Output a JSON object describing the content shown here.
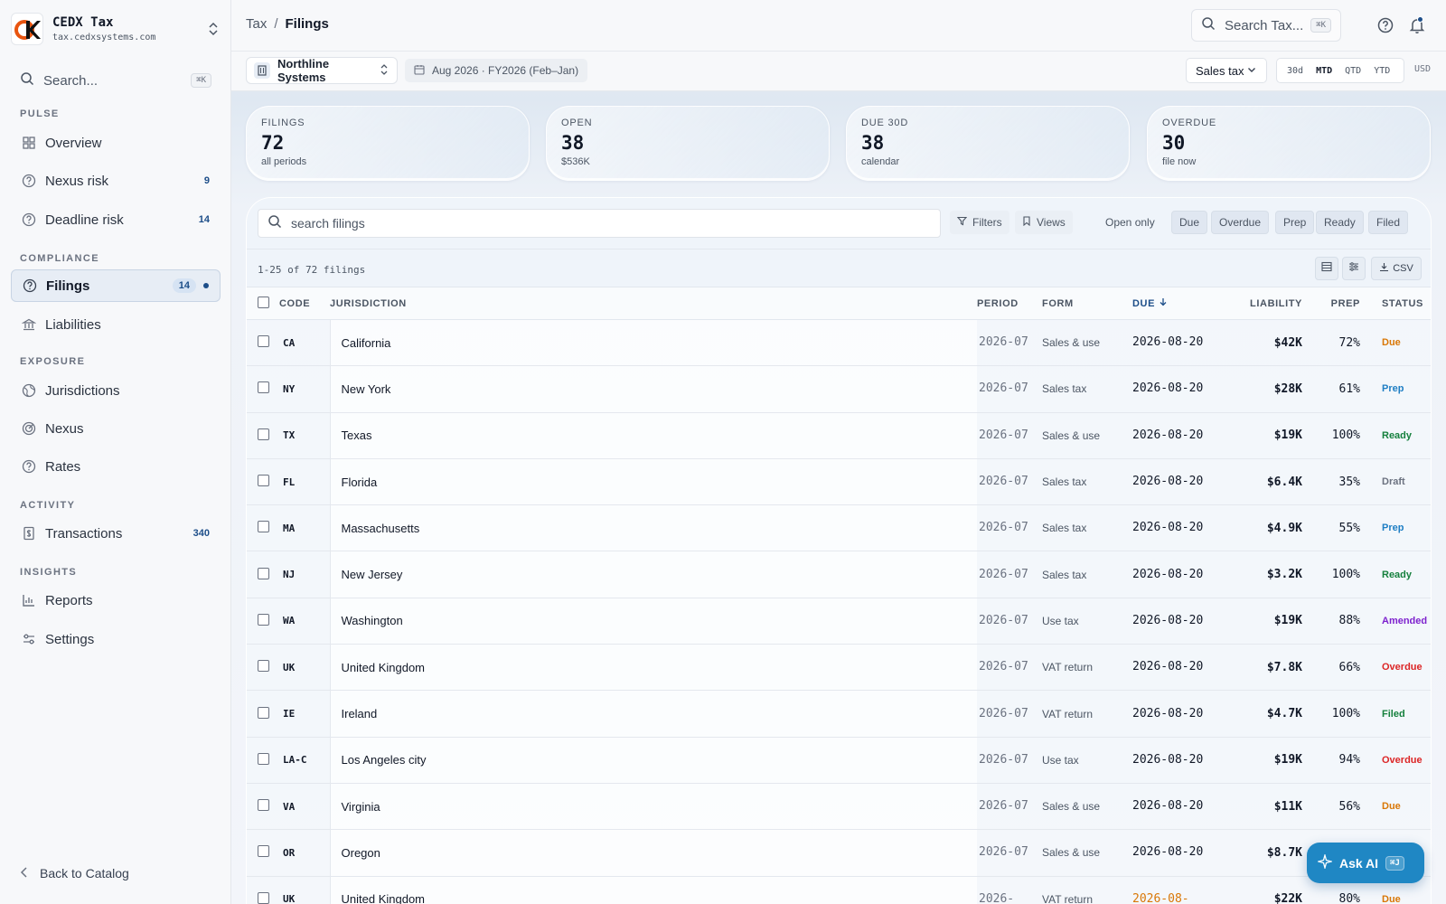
{
  "app": {
    "name": "CEDX Tax",
    "domain": "tax.cedxsystems.com",
    "search_placeholder": "Search...",
    "search_kbd": "⌘K"
  },
  "sidebar": {
    "sections": {
      "pulse": "PULSE",
      "compliance": "COMPLIANCE",
      "exposure": "EXPOSURE",
      "activity": "ACTIVITY",
      "insights": "INSIGHTS"
    },
    "items": {
      "overview": {
        "label": "Overview",
        "icon": "grid-icon"
      },
      "nexus_risk": {
        "label": "Nexus risk",
        "count": "9",
        "icon": "help-circle-icon"
      },
      "deadline_risk": {
        "label": "Deadline risk",
        "count": "14",
        "icon": "help-circle-icon"
      },
      "filings": {
        "label": "Filings",
        "count": "14",
        "icon": "help-circle-icon",
        "active": true
      },
      "liabilities": {
        "label": "Liabilities",
        "icon": "bank-icon"
      },
      "jurisdictions": {
        "label": "Jurisdictions",
        "icon": "globe-icon"
      },
      "nexus": {
        "label": "Nexus",
        "icon": "radar-icon"
      },
      "rates": {
        "label": "Rates",
        "icon": "help-circle-icon"
      },
      "transactions": {
        "label": "Transactions",
        "count": "340",
        "icon": "receipt-icon"
      },
      "reports": {
        "label": "Reports",
        "icon": "bar-chart-icon"
      },
      "settings": {
        "label": "Settings",
        "icon": "sliders-icon"
      }
    },
    "back_label": "Back to Catalog"
  },
  "header": {
    "breadcrumb": [
      "Tax",
      "Filings"
    ],
    "search_placeholder": "Search Tax...",
    "search_kbd": "⌘K"
  },
  "toolbar": {
    "entity": "Northline Systems",
    "period": "Aug 2026 · FY2026 (Feb–Jan)",
    "tax_type": "Sales tax",
    "ranges": [
      "30d",
      "MTD",
      "QTD",
      "YTD"
    ],
    "active_range": "MTD",
    "currency": "USD"
  },
  "kpis": [
    {
      "label": "FILINGS",
      "value": "72",
      "sub": "all periods"
    },
    {
      "label": "OPEN",
      "value": "38",
      "sub": "$536K"
    },
    {
      "label": "DUE 30D",
      "value": "38",
      "sub": "calendar"
    },
    {
      "label": "OVERDUE",
      "value": "30",
      "sub": "file now"
    }
  ],
  "table": {
    "search_placeholder": "search filings",
    "filters_label": "Filters",
    "views_label": "Views",
    "chips": [
      "Open only",
      "Due",
      "Overdue",
      "Prep",
      "Ready",
      "Filed"
    ],
    "count_text": "1-25 of 72 filings",
    "csv_label": "CSV",
    "columns": [
      "CODE",
      "JURISDICTION",
      "PERIOD",
      "FORM",
      "DUE",
      "LIABILITY",
      "PREP",
      "STATUS"
    ],
    "rows": [
      {
        "code": "CA",
        "jurisdiction": "California",
        "period": "2026-07",
        "form": "Sales & use",
        "due": "2026-08-20",
        "liability": "$42K",
        "prep": "72%",
        "status": "Due"
      },
      {
        "code": "NY",
        "jurisdiction": "New York",
        "period": "2026-07",
        "form": "Sales tax",
        "due": "2026-08-20",
        "liability": "$28K",
        "prep": "61%",
        "status": "Prep"
      },
      {
        "code": "TX",
        "jurisdiction": "Texas",
        "period": "2026-07",
        "form": "Sales & use",
        "due": "2026-08-20",
        "liability": "$19K",
        "prep": "100%",
        "status": "Ready"
      },
      {
        "code": "FL",
        "jurisdiction": "Florida",
        "period": "2026-07",
        "form": "Sales tax",
        "due": "2026-08-20",
        "liability": "$6.4K",
        "prep": "35%",
        "status": "Draft"
      },
      {
        "code": "MA",
        "jurisdiction": "Massachusetts",
        "period": "2026-07",
        "form": "Sales tax",
        "due": "2026-08-20",
        "liability": "$4.9K",
        "prep": "55%",
        "status": "Prep"
      },
      {
        "code": "NJ",
        "jurisdiction": "New Jersey",
        "period": "2026-07",
        "form": "Sales tax",
        "due": "2026-08-20",
        "liability": "$3.2K",
        "prep": "100%",
        "status": "Ready"
      },
      {
        "code": "WA",
        "jurisdiction": "Washington",
        "period": "2026-07",
        "form": "Use tax",
        "due": "2026-08-20",
        "liability": "$19K",
        "prep": "88%",
        "status": "Amended"
      },
      {
        "code": "UK",
        "jurisdiction": "United Kingdom",
        "period": "2026-07",
        "form": "VAT return",
        "due": "2026-08-20",
        "liability": "$7.8K",
        "prep": "66%",
        "status": "Overdue"
      },
      {
        "code": "IE",
        "jurisdiction": "Ireland",
        "period": "2026-07",
        "form": "VAT return",
        "due": "2026-08-20",
        "liability": "$4.7K",
        "prep": "100%",
        "status": "Filed"
      },
      {
        "code": "LA-C",
        "jurisdiction": "Los Angeles city",
        "period": "2026-07",
        "form": "Use tax",
        "due": "2026-08-20",
        "liability": "$19K",
        "prep": "94%",
        "status": "Overdue"
      },
      {
        "code": "VA",
        "jurisdiction": "Virginia",
        "period": "2026-07",
        "form": "Sales & use",
        "due": "2026-08-20",
        "liability": "$11K",
        "prep": "56%",
        "status": "Due"
      },
      {
        "code": "OR",
        "jurisdiction": "Oregon",
        "period": "2026-07",
        "form": "Sales & use",
        "due": "2026-08-20",
        "liability": "$8.7K",
        "prep": "",
        "status": ""
      },
      {
        "code": "UK",
        "jurisdiction": "United Kingdom",
        "period": "2026-",
        "form": "VAT return",
        "due": "2026-08-",
        "liability": "$22K",
        "prep": "80%",
        "status": "Due",
        "due_warn": true
      }
    ]
  },
  "status_colors": {
    "Due": "#d97706",
    "Prep": "#1f7fc4",
    "Ready": "#15803d",
    "Draft": "#6b7280",
    "Amended": "#7e22ce",
    "Overdue": "#dc2626",
    "Filed": "#15803d"
  },
  "ask_ai": {
    "label": "Ask AI",
    "kbd": "⌘J"
  }
}
